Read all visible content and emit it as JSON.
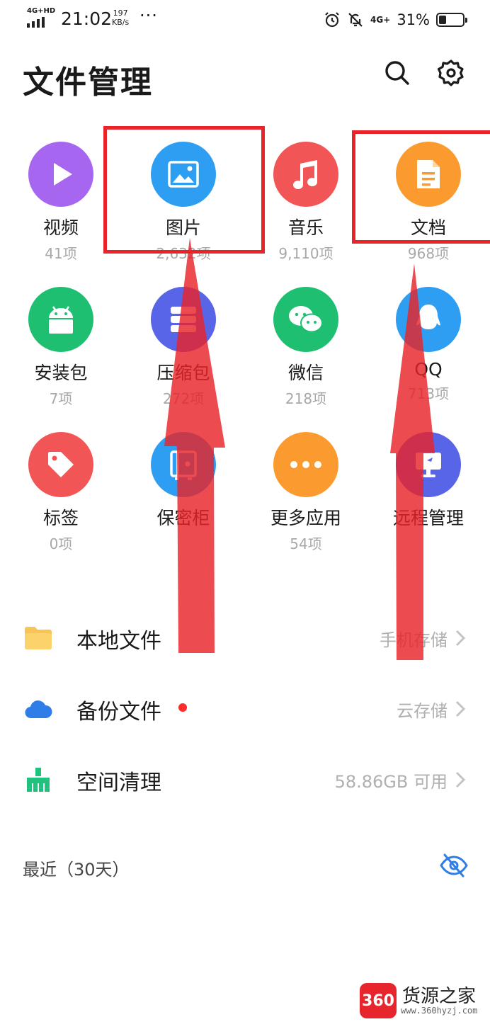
{
  "status_bar": {
    "network_left": "4G+HD",
    "time": "21:02",
    "speed_value": "197",
    "speed_unit": "KB/s",
    "more": "···",
    "network_right": "4G+",
    "battery": "31%",
    "battery_level": 0.31
  },
  "header": {
    "title": "文件管理",
    "search_icon": "search-icon",
    "settings_icon": "gear-icon"
  },
  "categories": [
    {
      "label": "视频",
      "count": "41项",
      "icon": "play-icon",
      "color": "#a766f0"
    },
    {
      "label": "图片",
      "count": "2,632项",
      "icon": "image-icon",
      "color": "#2e9ef2"
    },
    {
      "label": "音乐",
      "count": "9,110项",
      "icon": "music-note-icon",
      "color": "#f25555"
    },
    {
      "label": "文档",
      "count": "968项",
      "icon": "document-icon",
      "color": "#fb9b2f"
    },
    {
      "label": "安装包",
      "count": "7项",
      "icon": "android-icon",
      "color": "#1fbf72"
    },
    {
      "label": "压缩包",
      "count": "272项",
      "icon": "archive-icon",
      "color": "#5865e6"
    },
    {
      "label": "微信",
      "count": "218项",
      "icon": "wechat-icon",
      "color": "#1fbf72"
    },
    {
      "label": "QQ",
      "count": "713项",
      "icon": "qq-penguin-icon",
      "color": "#2e9ef2"
    },
    {
      "label": "标签",
      "count": "0项",
      "icon": "tag-icon",
      "color": "#f25555"
    },
    {
      "label": "保密柜",
      "count": "",
      "icon": "safe-icon",
      "color": "#2e9ef2"
    },
    {
      "label": "更多应用",
      "count": "54项",
      "icon": "more-dots-icon",
      "color": "#fb9b2f"
    },
    {
      "label": "远程管理",
      "count": "",
      "icon": "monitor-icon",
      "color": "#5865e6"
    }
  ],
  "list": [
    {
      "title": "本地文件",
      "sub": "手机存储",
      "icon": "folder-icon",
      "dot": false
    },
    {
      "title": "备份文件",
      "sub": "云存储",
      "icon": "cloud-icon",
      "dot": true
    },
    {
      "title": "空间清理",
      "sub": "58.86GB 可用",
      "icon": "broom-icon",
      "dot": false
    }
  ],
  "recent": {
    "label": "最近（30天）",
    "toggle_icon": "eye-off-icon"
  },
  "watermark": {
    "badge": "360",
    "name": "货源之家",
    "url": "www.360hyzj.com"
  },
  "colors": {
    "annotation": "#e8232a",
    "secondary_text": "#a8a8a8",
    "accent_blue": "#2e9ef2"
  }
}
